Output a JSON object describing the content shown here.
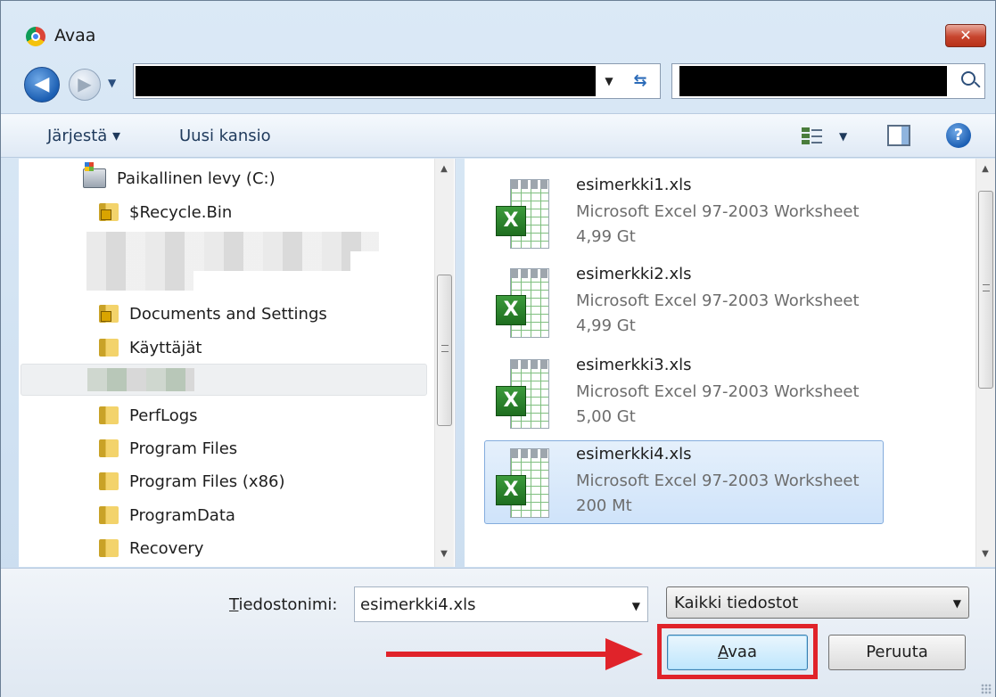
{
  "window": {
    "title": "Avaa",
    "close_label": "✕"
  },
  "address": {
    "back_glyph": "◀",
    "forward_glyph": "▶",
    "refresh_glyph": "⇆"
  },
  "toolbar": {
    "organize_label": "Järjestä ▾",
    "new_folder_label": "Uusi kansio",
    "help_label": "?"
  },
  "tree": {
    "items": [
      {
        "label": "Paikallinen levy (C:)",
        "icon": "drive-icon"
      },
      {
        "label": "$Recycle.Bin",
        "icon": "locked-folder-icon"
      },
      {
        "label": "Documents and Settings",
        "icon": "locked-folder-icon"
      },
      {
        "label": "Käyttäjät",
        "icon": "folder-icon"
      },
      {
        "label": "PerfLogs",
        "icon": "folder-icon"
      },
      {
        "label": "Program Files",
        "icon": "folder-icon"
      },
      {
        "label": "Program Files (x86)",
        "icon": "folder-icon"
      },
      {
        "label": "ProgramData",
        "icon": "folder-icon"
      },
      {
        "label": "Recovery",
        "icon": "folder-icon"
      }
    ]
  },
  "files": [
    {
      "name": "esimerkki1.xls",
      "type": "Microsoft Excel 97-2003 Worksheet",
      "size": "4,99 Gt",
      "selected": false
    },
    {
      "name": "esimerkki2.xls",
      "type": "Microsoft Excel 97-2003 Worksheet",
      "size": "4,99 Gt",
      "selected": false
    },
    {
      "name": "esimerkki3.xls",
      "type": "Microsoft Excel 97-2003 Worksheet",
      "size": "5,00 Gt",
      "selected": false
    },
    {
      "name": "esimerkki4.xls",
      "type": "Microsoft Excel 97-2003 Worksheet",
      "size": "200 Mt",
      "selected": true
    }
  ],
  "bottom": {
    "filename_label_first": "T",
    "filename_label_rest": "iedostonimi:",
    "filename_value": "esimerkki4.xls",
    "filetype_value": "Kaikki tiedostot",
    "open_label_first": "A",
    "open_label_rest": "vaa",
    "cancel_label": "Peruuta"
  },
  "colors": {
    "annotation": "#e0232a",
    "selection": "#cfe3fa"
  }
}
